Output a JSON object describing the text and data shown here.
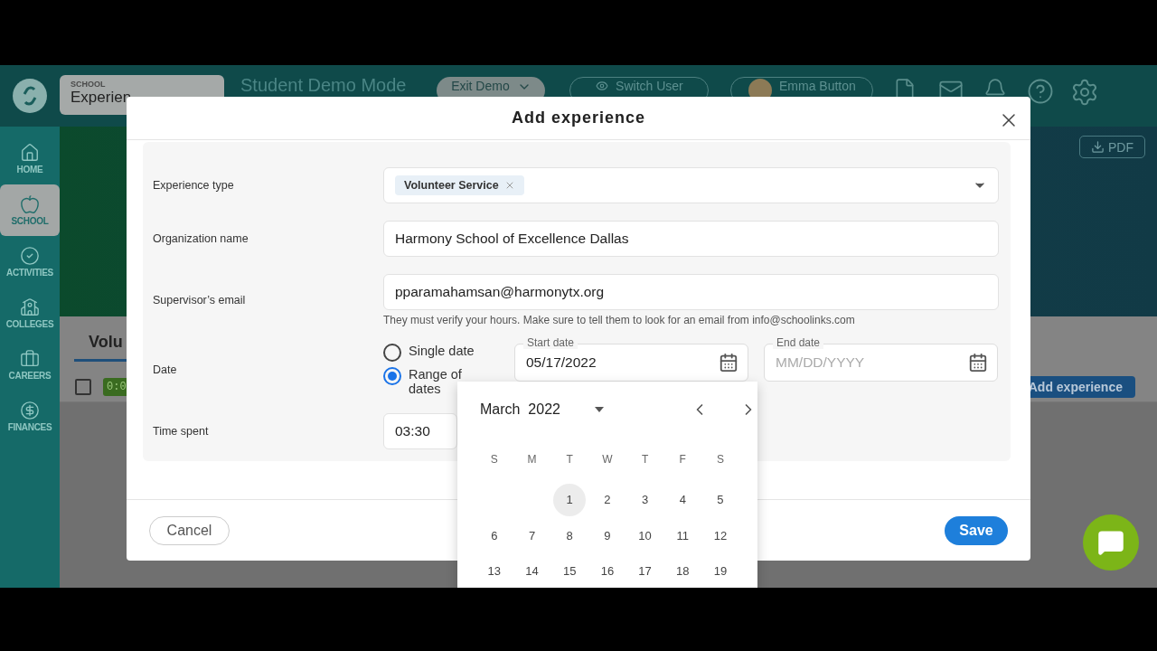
{
  "top_bar": {
    "school_switcher": {
      "label": "SCHOOL",
      "value": "Experien"
    },
    "mode_title": "Student Demo Mode",
    "exit_demo": "Exit Demo",
    "switch_user": "Switch User",
    "user": "Emma Button"
  },
  "sidebar": {
    "items": [
      {
        "label": "HOME",
        "kind": "home",
        "selected": false
      },
      {
        "label": "SCHOOL",
        "kind": "school",
        "selected": true
      },
      {
        "label": "ACTIVITIES",
        "kind": "activities",
        "selected": false
      },
      {
        "label": "COLLEGES",
        "kind": "colleges",
        "selected": false
      },
      {
        "label": "CAREERS",
        "kind": "careers",
        "selected": false
      },
      {
        "label": "FINANCES",
        "kind": "finances",
        "selected": false
      }
    ]
  },
  "page": {
    "pdf_button": "PDF",
    "tab": "Volu",
    "row_checked": false,
    "time_badge": "0:0",
    "add_button": "Add experience"
  },
  "modal": {
    "title": "Add experience",
    "fields": [
      {
        "kind": "select",
        "label": "Experience type",
        "chips": [
          "Volunteer Service"
        ]
      },
      {
        "kind": "text",
        "label": "Organization name",
        "value": "Harmony School of Excellence Dallas"
      },
      {
        "kind": "text",
        "label": "Supervisor’s email",
        "value": "pparamahamsan@harmonytx.org",
        "hint": "They must verify your hours. Make sure to tell them to look for an email from info@schoolinks.com"
      },
      {
        "kind": "date",
        "label": "Date",
        "options": [
          {
            "label": "Single date",
            "selected": false
          },
          {
            "label": "Range of dates",
            "selected": true
          }
        ],
        "start": {
          "label": "Start date",
          "value": "05/17/2022"
        },
        "end": {
          "label": "End date",
          "placeholder": "MM/DD/YYYY"
        }
      },
      {
        "kind": "time",
        "label": "Time spent",
        "value": "03:30"
      }
    ],
    "cancel": "Cancel",
    "save": "Save"
  },
  "calendar": {
    "month": "March",
    "year": "2022",
    "weekdays": [
      "S",
      "M",
      "T",
      "W",
      "T",
      "F",
      "S"
    ],
    "weeks": [
      {
        "starts_late": true,
        "days": [
          {
            "day": "1",
            "hovered": true
          },
          {
            "day": "2",
            "hovered": false
          },
          {
            "day": "3",
            "hovered": false
          },
          {
            "day": "4",
            "hovered": false
          },
          {
            "day": "5",
            "hovered": false
          }
        ]
      },
      {
        "days": [
          {
            "day": "6",
            "hovered": false
          },
          {
            "day": "7",
            "hovered": false
          },
          {
            "day": "8",
            "hovered": false
          },
          {
            "day": "9",
            "hovered": false
          },
          {
            "day": "10",
            "hovered": false
          },
          {
            "day": "11",
            "hovered": false
          },
          {
            "day": "12",
            "hovered": false
          }
        ]
      },
      {
        "days": [
          {
            "day": "13",
            "hovered": false
          },
          {
            "day": "14",
            "hovered": false
          },
          {
            "day": "15",
            "hovered": false
          },
          {
            "day": "16",
            "hovered": false
          },
          {
            "day": "17",
            "hovered": false
          },
          {
            "day": "18",
            "hovered": false
          },
          {
            "day": "19",
            "hovered": false
          }
        ]
      }
    ]
  }
}
